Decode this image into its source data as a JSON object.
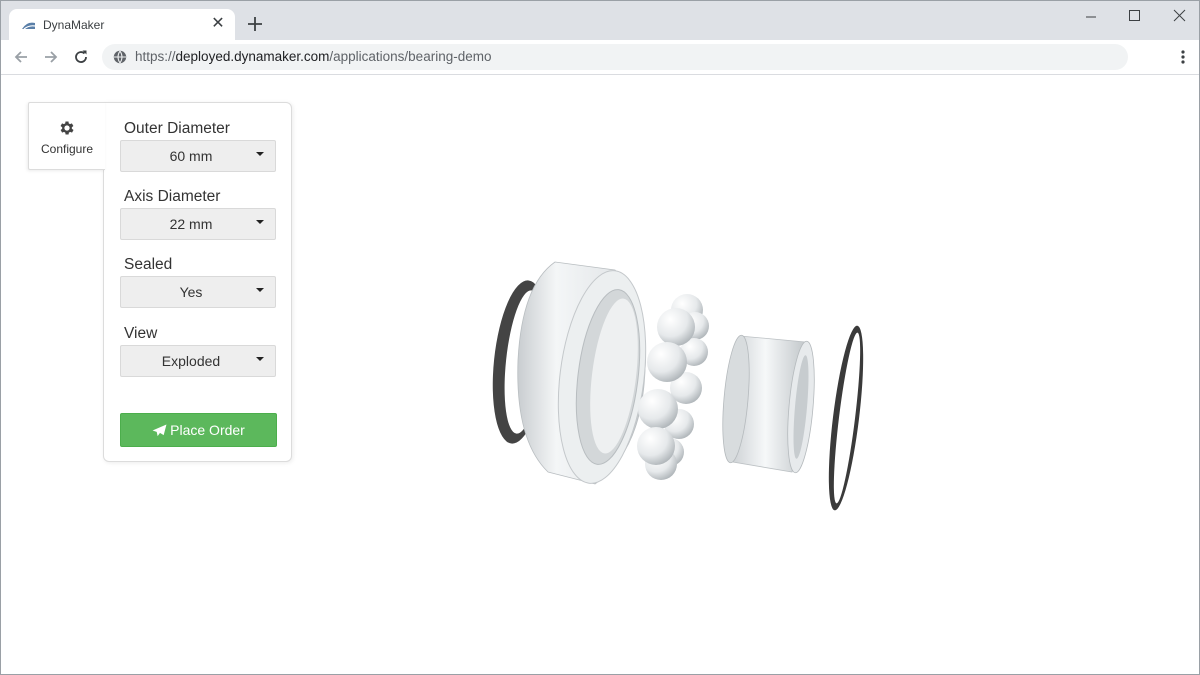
{
  "browser": {
    "tab_title": "DynaMaker",
    "url_scheme": "https://",
    "url_host": "deployed.dynamaker.com",
    "url_path": "/applications/bearing-demo"
  },
  "configurator": {
    "configure_label": "Configure",
    "fields": [
      {
        "label": "Outer Diameter",
        "value": "60 mm"
      },
      {
        "label": "Axis Diameter",
        "value": "22 mm"
      },
      {
        "label": "Sealed",
        "value": "Yes"
      },
      {
        "label": "View",
        "value": "Exploded"
      }
    ],
    "order_label": "Place Order"
  },
  "colors": {
    "order_button": "#5cb85c",
    "tabstrip": "#dee1e6",
    "omnibox": "#f1f3f4"
  },
  "icons": [
    "gear-icon",
    "paper-plane-icon",
    "globe-icon",
    "back-arrow-icon",
    "forward-arrow-icon",
    "reload-icon",
    "close-icon",
    "plus-icon",
    "more-vert-icon"
  ],
  "viewport": {
    "model": "bearing",
    "view": "exploded"
  }
}
